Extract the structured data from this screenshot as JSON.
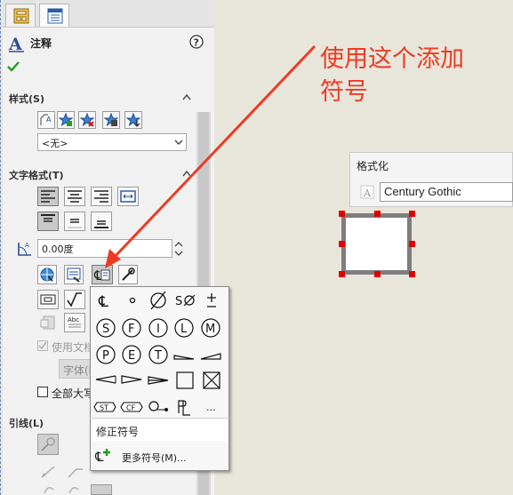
{
  "panel": {
    "title": "注释",
    "help_icon": "help-icon",
    "confirm_icon": "check-icon",
    "sections": {
      "style": {
        "title": "样式(S)",
        "select_value": "<无>"
      },
      "text_format": {
        "title": "文字格式(T)",
        "angle_value": "0.00度",
        "use_doc_font": "使用文档字体",
        "font_button": "字体(F)...",
        "all_caps": "全部大写"
      },
      "leader": {
        "title": "引线(L)"
      }
    }
  },
  "canvas": {
    "format_title": "格式化",
    "font_name": "Century Gothic"
  },
  "annotation_text": [
    "使用这个添加",
    "符号"
  ],
  "popup": {
    "symbols_row1": [
      "℄",
      "°",
      "⌀",
      "S⌀",
      "±"
    ],
    "symbols_row2": [
      "S",
      "F",
      "I",
      "L",
      "M"
    ],
    "symbols_row3": [
      "P",
      "E",
      "T"
    ],
    "symbols_row5": [
      "ST",
      "CF"
    ],
    "more_dots": "...",
    "selected_item": "修正符号",
    "more_symbols": "更多符号(M)..."
  },
  "colors": {
    "annotation": "#ee3a24",
    "handle": "#e00000",
    "accent": "#2a6fd6"
  }
}
